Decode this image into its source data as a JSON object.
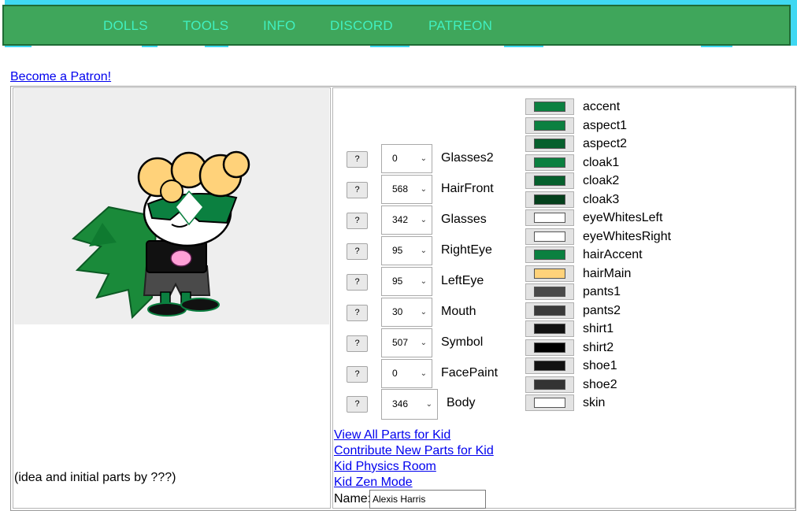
{
  "nav": {
    "items": [
      "DOLLS",
      "TOOLS",
      "INFO",
      "DISCORD",
      "PATREON"
    ],
    "bg_color": "#3fa65b",
    "text_color": "#40f0c0"
  },
  "patron_link": "Become a Patron!",
  "credit": "(idea and initial parts by ???)",
  "help_label": "?",
  "parts": [
    {
      "name": "Glasses2",
      "value": "0"
    },
    {
      "name": "HairFront",
      "value": "568"
    },
    {
      "name": "Glasses",
      "value": "342"
    },
    {
      "name": "RightEye",
      "value": "95"
    },
    {
      "name": "LeftEye",
      "value": "95"
    },
    {
      "name": "Mouth",
      "value": "30"
    },
    {
      "name": "Symbol",
      "value": "507"
    },
    {
      "name": "FacePaint",
      "value": "0"
    },
    {
      "name": "Body",
      "value": "346"
    }
  ],
  "colors": [
    {
      "name": "accent",
      "hex": "#0b8040"
    },
    {
      "name": "aspect1",
      "hex": "#0b8040"
    },
    {
      "name": "aspect2",
      "hex": "#06602d"
    },
    {
      "name": "cloak1",
      "hex": "#0b8040"
    },
    {
      "name": "cloak2",
      "hex": "#06602d"
    },
    {
      "name": "cloak3",
      "hex": "#04401c"
    },
    {
      "name": "eyeWhitesLeft",
      "hex": "#ffffff"
    },
    {
      "name": "eyeWhitesRight",
      "hex": "#ffffff"
    },
    {
      "name": "hairAccent",
      "hex": "#0b8040"
    },
    {
      "name": "hairMain",
      "hex": "#ffd27a"
    },
    {
      "name": "pants1",
      "hex": "#4a4a4a"
    },
    {
      "name": "pants2",
      "hex": "#3a3a3a"
    },
    {
      "name": "shirt1",
      "hex": "#111111"
    },
    {
      "name": "shirt2",
      "hex": "#000000"
    },
    {
      "name": "shoe1",
      "hex": "#111111"
    },
    {
      "name": "shoe2",
      "hex": "#333333"
    },
    {
      "name": "skin",
      "hex": "#ffffff"
    }
  ],
  "links": [
    "View All Parts for Kid",
    "Contribute New Parts for Kid",
    "Kid Physics Room",
    "Kid Zen Mode"
  ],
  "name_field": {
    "label": "Name:",
    "value": "Alexis Harris"
  }
}
